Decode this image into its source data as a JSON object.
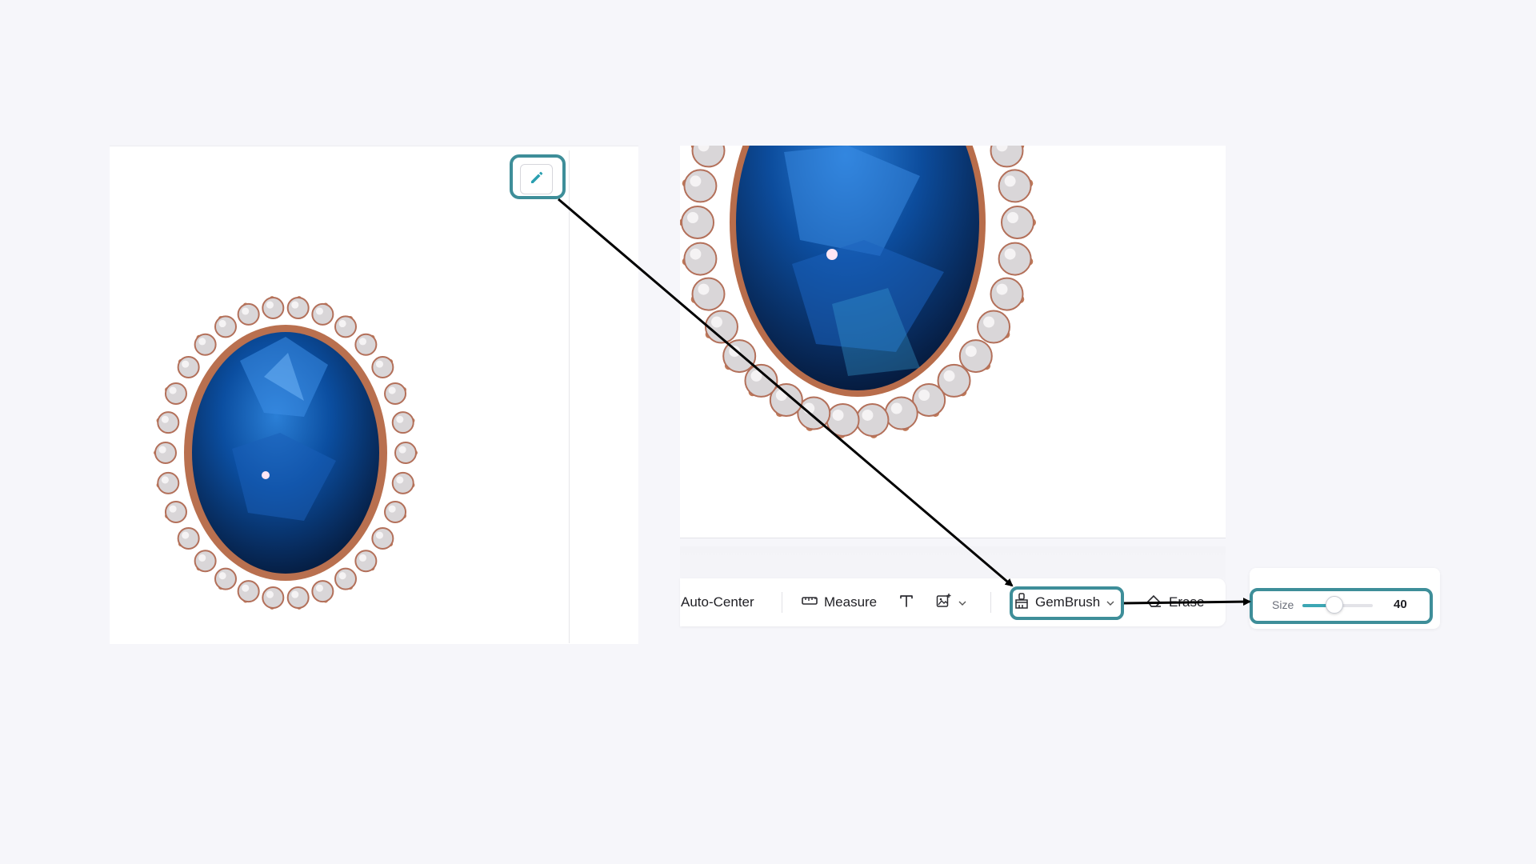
{
  "toolbar": {
    "auto_center_label": "Auto-Center",
    "measure_label": "Measure",
    "text_tool_icon": "text-type-icon",
    "image_tool_icon": "image-add-icon",
    "gembrush_label": "GemBrush",
    "erase_label": "Erase"
  },
  "left_panel": {
    "edit_icon": "pencil-icon"
  },
  "brush_size": {
    "label": "Size",
    "value": "40",
    "fraction": 0.45
  },
  "colors": {
    "highlight": "#3e8e99",
    "slider_fill": "#3ca6b4",
    "background": "#f6f6fa"
  }
}
